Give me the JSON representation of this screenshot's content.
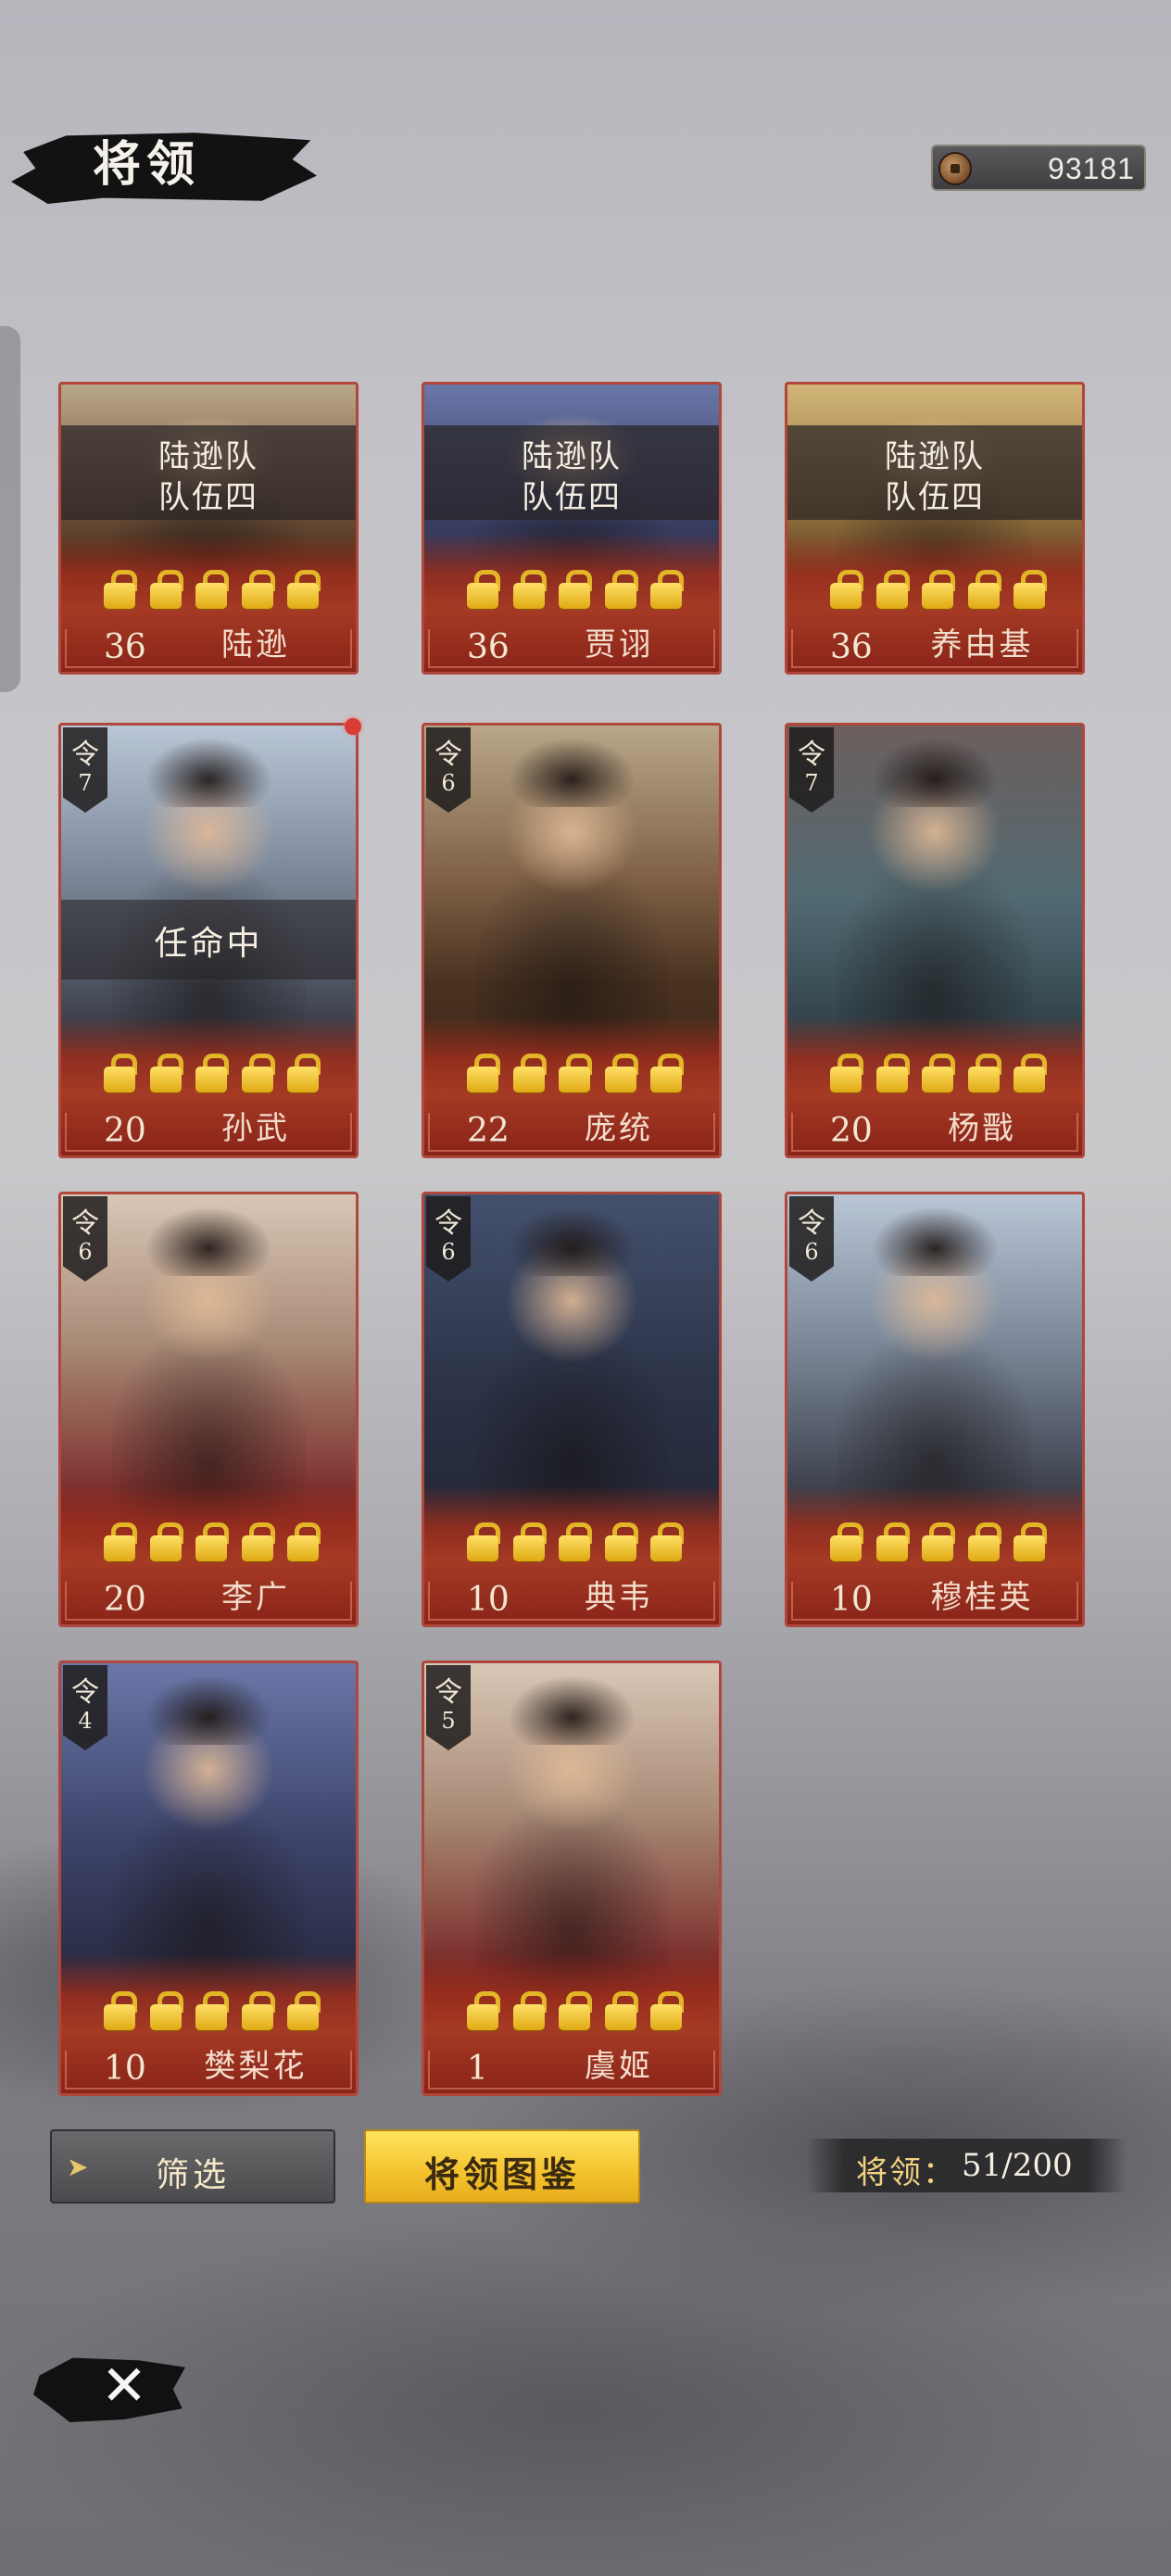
{
  "header": {
    "title": "将领",
    "currency": {
      "icon": "coin-icon",
      "value": "93181"
    }
  },
  "heroes": [
    {
      "name": "陆逊",
      "level": "36",
      "team_line1": "陆逊队",
      "team_line2": "队伍四",
      "locks": 5,
      "skin": "warm"
    },
    {
      "name": "贾诩",
      "level": "36",
      "team_line1": "陆逊队",
      "team_line2": "队伍四",
      "locks": 5,
      "skin": "cool"
    },
    {
      "name": "养由基",
      "level": "36",
      "team_line1": "陆逊队",
      "team_line2": "队伍四",
      "locks": 5,
      "skin": "gold"
    },
    {
      "name": "孙武",
      "level": "20",
      "command_label": "令",
      "command": "7",
      "status": "任命中",
      "locks": 5,
      "skin": "sky"
    },
    {
      "name": "庞统",
      "level": "22",
      "command_label": "令",
      "command": "6",
      "locks": 5,
      "skin": "warm"
    },
    {
      "name": "杨戬",
      "level": "20",
      "command_label": "令",
      "command": "7",
      "locks": 5,
      "skin": "teal"
    },
    {
      "name": "李广",
      "level": "20",
      "command_label": "令",
      "command": "6",
      "locks": 5,
      "skin": "red"
    },
    {
      "name": "典韦",
      "level": "10",
      "command_label": "令",
      "command": "6",
      "locks": 5,
      "skin": "dark"
    },
    {
      "name": "穆桂英",
      "level": "10",
      "command_label": "令",
      "command": "6",
      "locks": 5,
      "skin": "sky"
    },
    {
      "name": "樊梨花",
      "level": "10",
      "command_label": "令",
      "command": "4",
      "locks": 5,
      "skin": "cool"
    },
    {
      "name": "虞姬",
      "level": "1",
      "command_label": "令",
      "command": "5",
      "locks": 5,
      "skin": "red"
    }
  ],
  "footer": {
    "filter_label": "筛选",
    "codex_label": "将领图鉴",
    "count_label": "将领：",
    "count_value": "51/200"
  },
  "colors": {
    "card_border": "#b0473c",
    "lock_gold": "#e3b628",
    "codex_button": "#f4c22d",
    "notification_dot": "#d93b35"
  }
}
